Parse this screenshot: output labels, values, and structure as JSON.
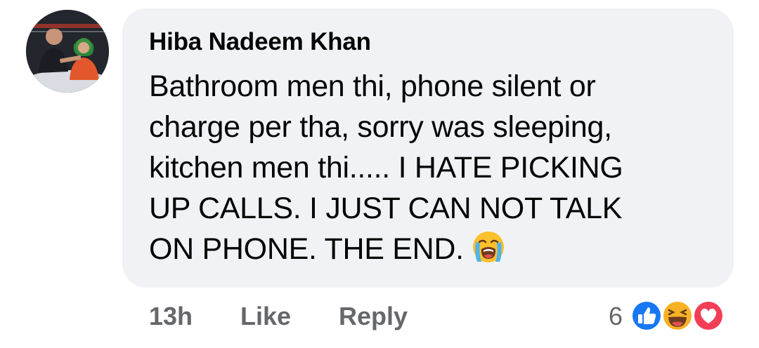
{
  "comment": {
    "author": "Hiba Nadeem Khan",
    "lines": [
      "Bathroom men thi, phone silent or",
      "charge per tha, sorry was sleeping,",
      "kitchen men thi..... I HATE PICKING",
      "UP CALLS. I JUST CAN NOT TALK",
      "ON PHONE. THE END."
    ],
    "emoji": "loudly-crying-face-icon"
  },
  "actions": {
    "time": "13h",
    "like_label": "Like",
    "reply_label": "Reply"
  },
  "reactions": {
    "count": "6",
    "types": [
      "like-icon",
      "haha-icon",
      "love-icon"
    ],
    "colors": {
      "like": "#1877f2",
      "haha": "#f7b125",
      "love": "#f33e58"
    }
  },
  "colors": {
    "bubble": "#f0f2f5",
    "text": "#050505",
    "secondary": "#65676b"
  }
}
